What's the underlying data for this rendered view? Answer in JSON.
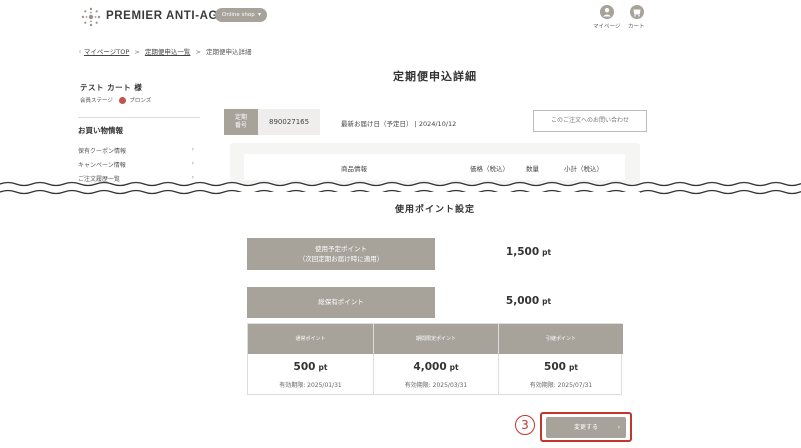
{
  "header": {
    "brand": "PREMIER ANTI-AGING",
    "shop_pill": "Online shop",
    "mypage_label": "マイページ",
    "cart_label": "カート"
  },
  "breadcrumb": [
    {
      "label": "マイページTOP"
    },
    {
      "label": "定期便申込一覧"
    },
    {
      "label": "定期便申込詳細"
    }
  ],
  "sidebar": {
    "user_name": "テスト カート 様",
    "stage_label": "会員ステージ",
    "stage_value": "ブロンズ",
    "section_title": "お買い物情報",
    "items": [
      {
        "label": "保有クーポン情報"
      },
      {
        "label": "キャンペーン情報"
      },
      {
        "label": "ご注文履歴一覧"
      }
    ]
  },
  "main": {
    "page_title": "定期便申込詳細",
    "order_label_line1": "定期",
    "order_label_line2": "番号",
    "order_number": "890027165",
    "next_delivery": "最新お届け日（予定日） | 2024/10/12",
    "contact_button": "このご注文へのお問い合わせ",
    "product_headers": {
      "info": "商品情報",
      "price": "価格（税込）",
      "qty": "数量",
      "subtotal": "小計（税込）"
    }
  },
  "points": {
    "section_title": "使用ポイント設定",
    "planned_label_line1": "使用予定ポイント",
    "planned_label_line2": "（次回定期お届け時に適用）",
    "planned_value": "1,500",
    "total_label": "総保有ポイント",
    "total_value": "5,000",
    "unit": "pt",
    "breakdown": [
      {
        "header": "通常ポイント",
        "value": "500",
        "expiry": "有効期限: 2025/01/31"
      },
      {
        "header": "期間限定ポイント",
        "value": "4,000",
        "expiry": "有効期限: 2025/03/31"
      },
      {
        "header": "引継ポイント",
        "value": "500",
        "expiry": "有効期限: 2025/07/31"
      }
    ],
    "step_marker": "3",
    "change_button": "変更する"
  },
  "colors": {
    "accent": "#a7a29a",
    "highlight": "#c0372c",
    "medal": "#c0554c"
  }
}
